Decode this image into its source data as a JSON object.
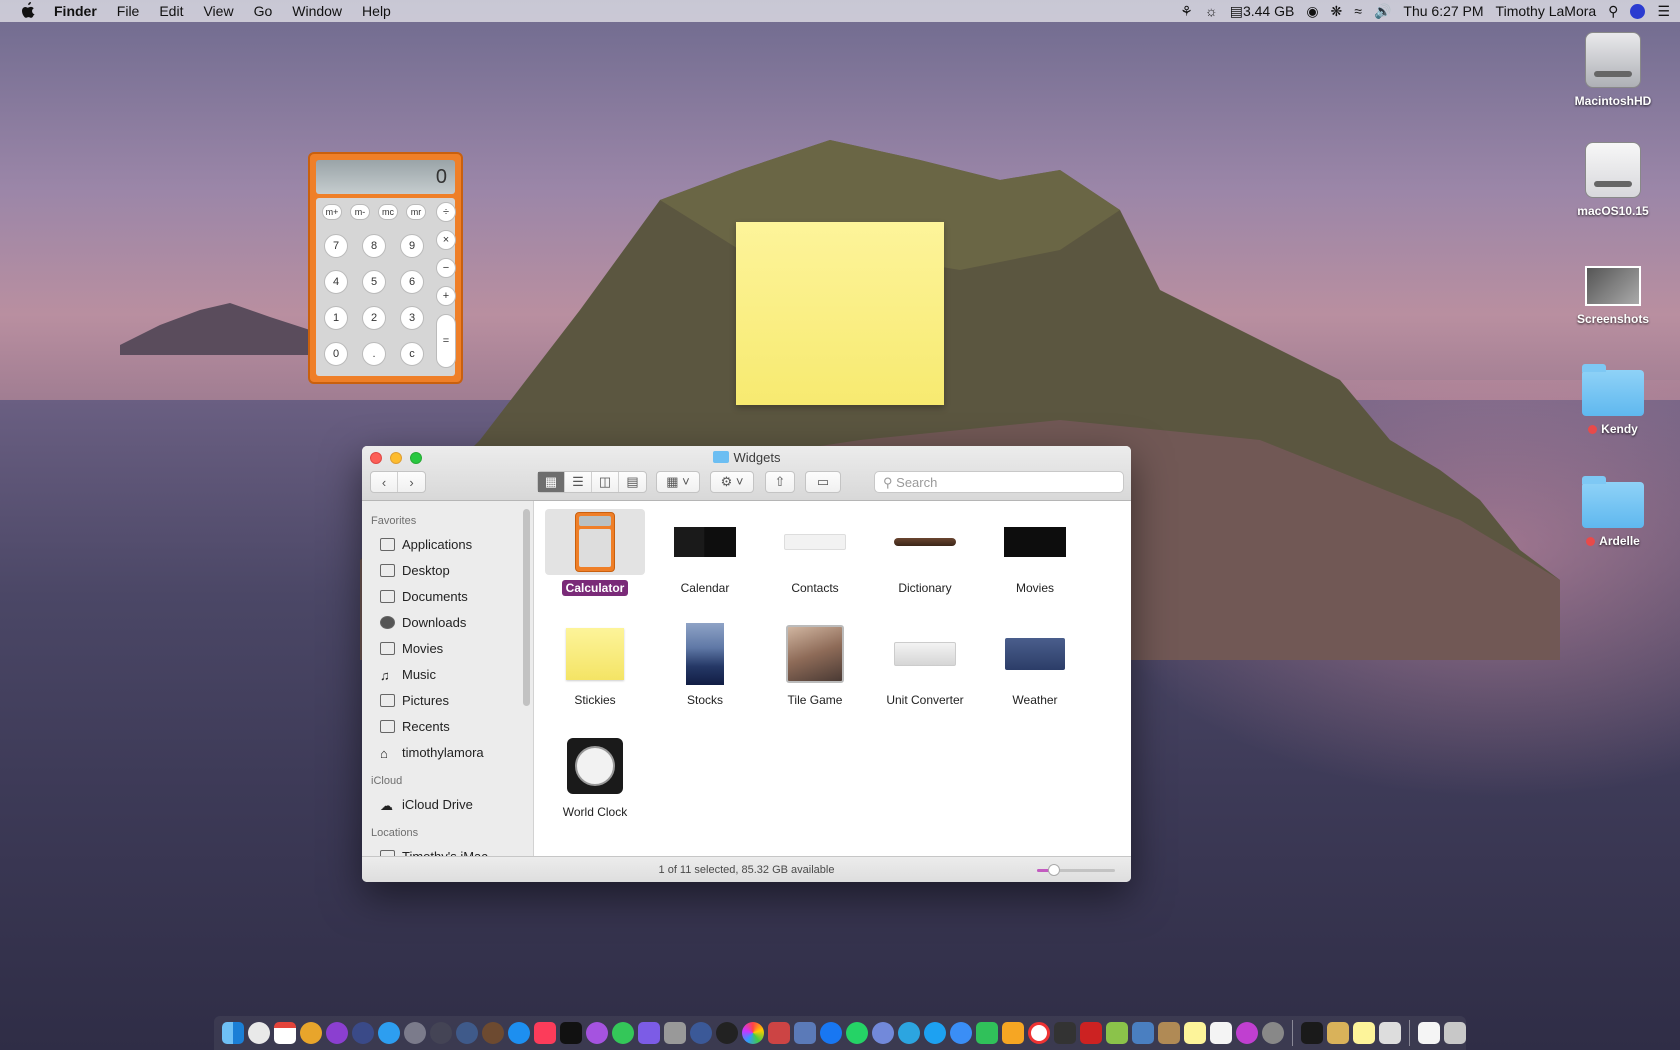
{
  "menubar": {
    "app": "Finder",
    "menus": [
      "File",
      "Edit",
      "View",
      "Go",
      "Window",
      "Help"
    ],
    "memory": "3.44 GB",
    "clock": "Thu 6:27 PM",
    "user": "Timothy LaMora"
  },
  "desktop": {
    "icons": [
      {
        "label": "MacintoshHD"
      },
      {
        "label": "macOS10.15"
      },
      {
        "label": "Screenshots"
      },
      {
        "label": "Kendy"
      },
      {
        "label": "Ardelle"
      }
    ]
  },
  "calculator": {
    "display": "0",
    "mem_buttons": [
      "m+",
      "m-",
      "mc",
      "mr"
    ],
    "ops": [
      "÷",
      "×",
      "−",
      "+",
      "="
    ],
    "digits": [
      "7",
      "8",
      "9",
      "4",
      "5",
      "6",
      "1",
      "2",
      "3",
      "0",
      ".",
      "c"
    ]
  },
  "finder": {
    "title": "Widgets",
    "search_placeholder": "Search",
    "sidebar": {
      "favorites_heading": "Favorites",
      "favorites": [
        "Applications",
        "Desktop",
        "Documents",
        "Downloads",
        "Movies",
        "Music",
        "Pictures",
        "Recents",
        "timothylamora"
      ],
      "icloud_heading": "iCloud",
      "icloud": [
        "iCloud Drive"
      ],
      "locations_heading": "Locations",
      "locations": [
        "Timothy's iMac"
      ]
    },
    "items": [
      {
        "name": "Calculator",
        "selected": true
      },
      {
        "name": "Calendar"
      },
      {
        "name": "Contacts"
      },
      {
        "name": "Dictionary"
      },
      {
        "name": "Movies"
      },
      {
        "name": "Stickies"
      },
      {
        "name": "Stocks"
      },
      {
        "name": "Tile Game"
      },
      {
        "name": "Unit Converter"
      },
      {
        "name": "Weather"
      },
      {
        "name": "World Clock"
      }
    ],
    "status": "1 of 11 selected, 85.32 GB available",
    "icon_size_level": 0.22
  },
  "colors": {
    "selection": "#7a2a78",
    "calculator": "#ef7f28",
    "sticky": "#fdf49a"
  }
}
